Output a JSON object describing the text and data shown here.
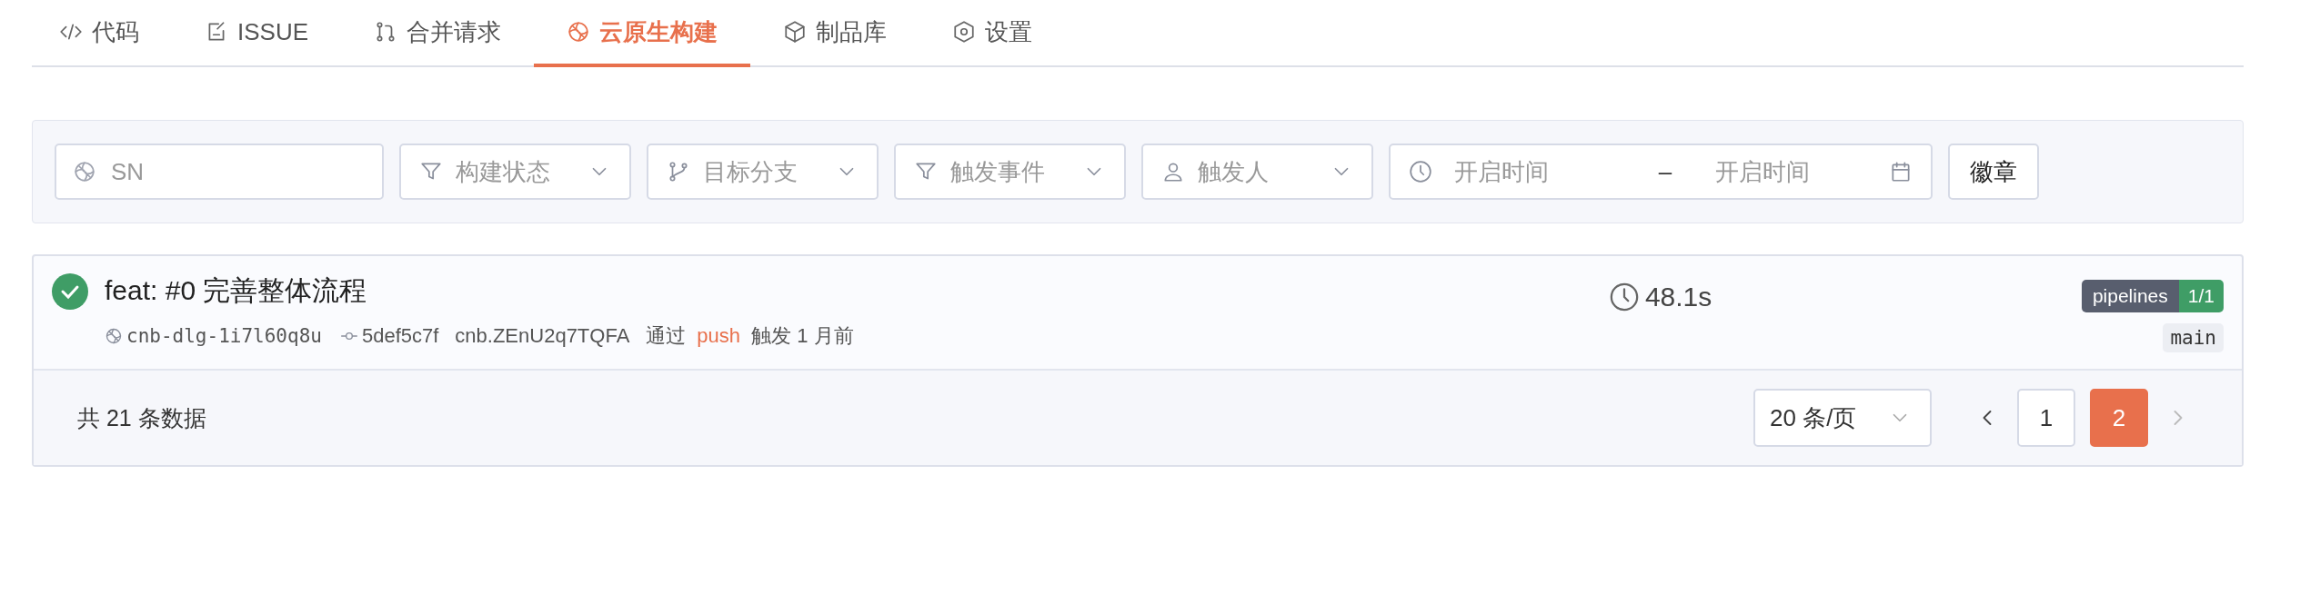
{
  "tabs": [
    {
      "label": "代码",
      "selected": false
    },
    {
      "label": "ISSUE",
      "selected": false
    },
    {
      "label": "合并请求",
      "selected": false
    },
    {
      "label": "云原生构建",
      "selected": true
    },
    {
      "label": "制品库",
      "selected": false
    },
    {
      "label": "设置",
      "selected": false
    }
  ],
  "filters": [
    {
      "kind": "input",
      "placeholder": "SN"
    },
    {
      "kind": "select",
      "placeholder": "构建状态"
    },
    {
      "kind": "select",
      "placeholder": "目标分支"
    },
    {
      "kind": "select",
      "placeholder": "触发事件"
    },
    {
      "kind": "select",
      "placeholder": "触发人"
    },
    {
      "kind": "daterange",
      "start_placeholder": "开启时间",
      "separator": "–",
      "end_placeholder": "开启时间"
    },
    {
      "kind": "button",
      "label": "徽章"
    }
  ],
  "builds": [
    {
      "kind": "success",
      "title": "feat: #0 完善整体流程",
      "sn": "cnb-dlg-1i7l60q8u",
      "commit": "5def5c7f",
      "user": "cnb.ZEnU2q7TQFA",
      "via": "通过",
      "event": "push",
      "trigger_text": "触发 1 月前",
      "duration": "48.1s",
      "badge_name": "pipelines",
      "badge_count": "1/1",
      "branch": "main"
    }
  ],
  "footer": {
    "total": "共 21 条数据",
    "page_size": "20 条/页",
    "pages": [
      {
        "label": "1",
        "selected": false
      },
      {
        "label": "2",
        "selected": true
      }
    ],
    "prev_disabled": false,
    "next_disabled": true
  }
}
